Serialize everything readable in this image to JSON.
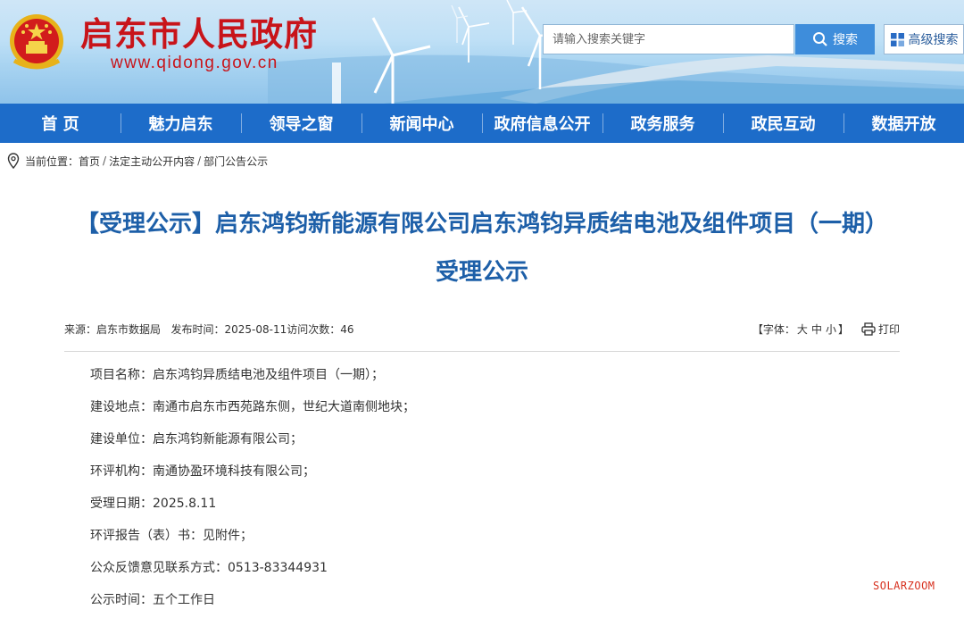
{
  "header": {
    "site_title": "启东市人民政府",
    "site_url": "www.qidong.gov.cn",
    "emblem_icon": "national-emblem",
    "search_placeholder": "请输入搜索关键字",
    "search_button": "搜索",
    "advanced_search_button": "高级搜索"
  },
  "nav": {
    "items": [
      {
        "label": "首 页"
      },
      {
        "label": "魅力启东"
      },
      {
        "label": "领导之窗"
      },
      {
        "label": "新闻中心"
      },
      {
        "label": "政府信息公开"
      },
      {
        "label": "政务服务"
      },
      {
        "label": "政民互动"
      },
      {
        "label": "数据开放"
      }
    ]
  },
  "breadcrumb": {
    "prefix": "当前位置：",
    "items": [
      "首页",
      "法定主动公开内容",
      "部门公告公示"
    ],
    "separator": "/"
  },
  "article": {
    "title": "【受理公示】启东鸿钧新能源有限公司启东鸿钧异质结电池及组件项目（一期）受理公示",
    "meta": {
      "source": "来源：启东市数据局",
      "publish_time": "发布时间：2025-08-11",
      "views": "访问次数：46",
      "font_prefix": "【字体：",
      "font_large": "大",
      "font_medium": "中",
      "font_small": "小",
      "font_suffix": "】",
      "print_label": "打印"
    },
    "rows": [
      "项目名称：启东鸿钧异质结电池及组件项目（一期）；",
      "建设地点：南通市启东市西苑路东侧，世纪大道南侧地块；",
      "建设单位：启东鸿钧新能源有限公司；",
      "环评机构：南通协盈环境科技有限公司；",
      "受理日期：2025.8.11",
      "环评报告（表）书：见附件；",
      "公众反馈意见联系方式：0513-83344931",
      "公示时间：五个工作日"
    ]
  },
  "watermark": "SOLARZOOM",
  "colors": {
    "nav_bg": "#1d6cc9",
    "title_red": "#c8141a",
    "article_title_blue": "#1d5fa8",
    "search_button_bg": "#3e8ddb",
    "watermark_red": "#d7301e"
  }
}
